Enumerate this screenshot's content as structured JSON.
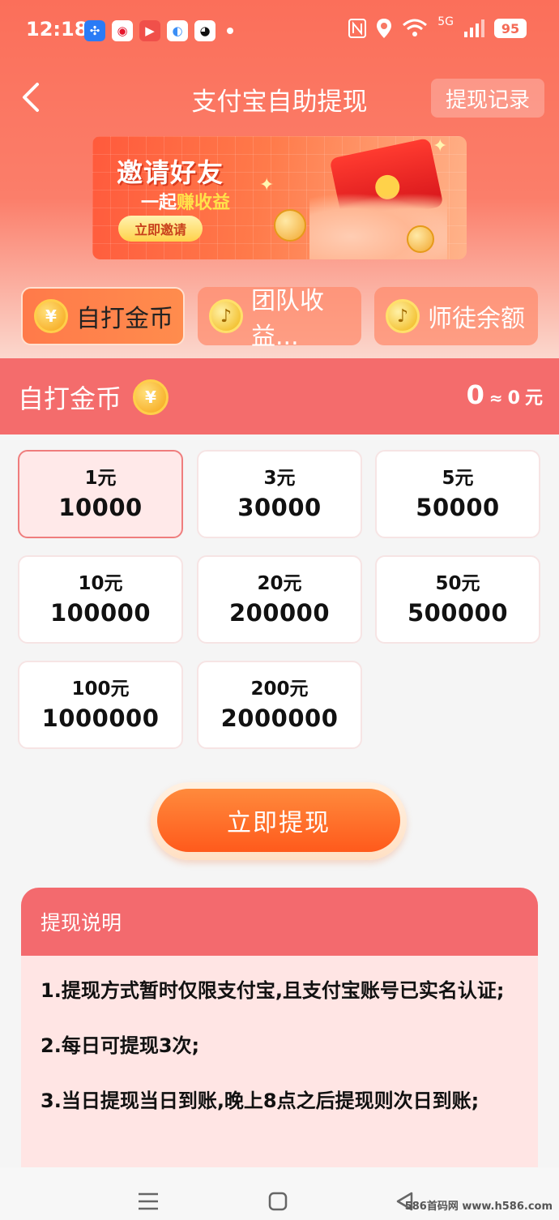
{
  "status_bar": {
    "time": "12:18",
    "network": "5G",
    "battery": "95"
  },
  "header": {
    "title": "支付宝自助提现",
    "record_button": "提现记录"
  },
  "banner": {
    "title": "邀请好友",
    "subtitle_prefix": "一起",
    "subtitle_highlight": "赚收益",
    "button": "立即邀请"
  },
  "tabs": [
    {
      "label": "自打金币"
    },
    {
      "label": "团队收益..."
    },
    {
      "label": "师徒余额"
    }
  ],
  "section": {
    "title": "自打金币",
    "coins": "0",
    "approx": "≈",
    "amount": "0",
    "unit": "元"
  },
  "options": [
    {
      "yuan": "1元",
      "coins": "10000"
    },
    {
      "yuan": "3元",
      "coins": "30000"
    },
    {
      "yuan": "5元",
      "coins": "50000"
    },
    {
      "yuan": "10元",
      "coins": "100000"
    },
    {
      "yuan": "20元",
      "coins": "200000"
    },
    {
      "yuan": "50元",
      "coins": "500000"
    },
    {
      "yuan": "100元",
      "coins": "1000000"
    },
    {
      "yuan": "200元",
      "coins": "2000000"
    }
  ],
  "withdraw_button": "立即提现",
  "description": {
    "title": "提现说明",
    "items": [
      "1.提现方式暂时仅限支付宝,且支付宝账号已实名认证;",
      "2.每日可提现3次;",
      "3.当日提现当日到账,晚上8点之后提现则次日到账;"
    ]
  },
  "watermark": "586首码网 www.h586.com",
  "colors": {
    "accent": "#f46c6c",
    "button": "#ff5a1c",
    "selected_border": "#ef7d7d"
  }
}
